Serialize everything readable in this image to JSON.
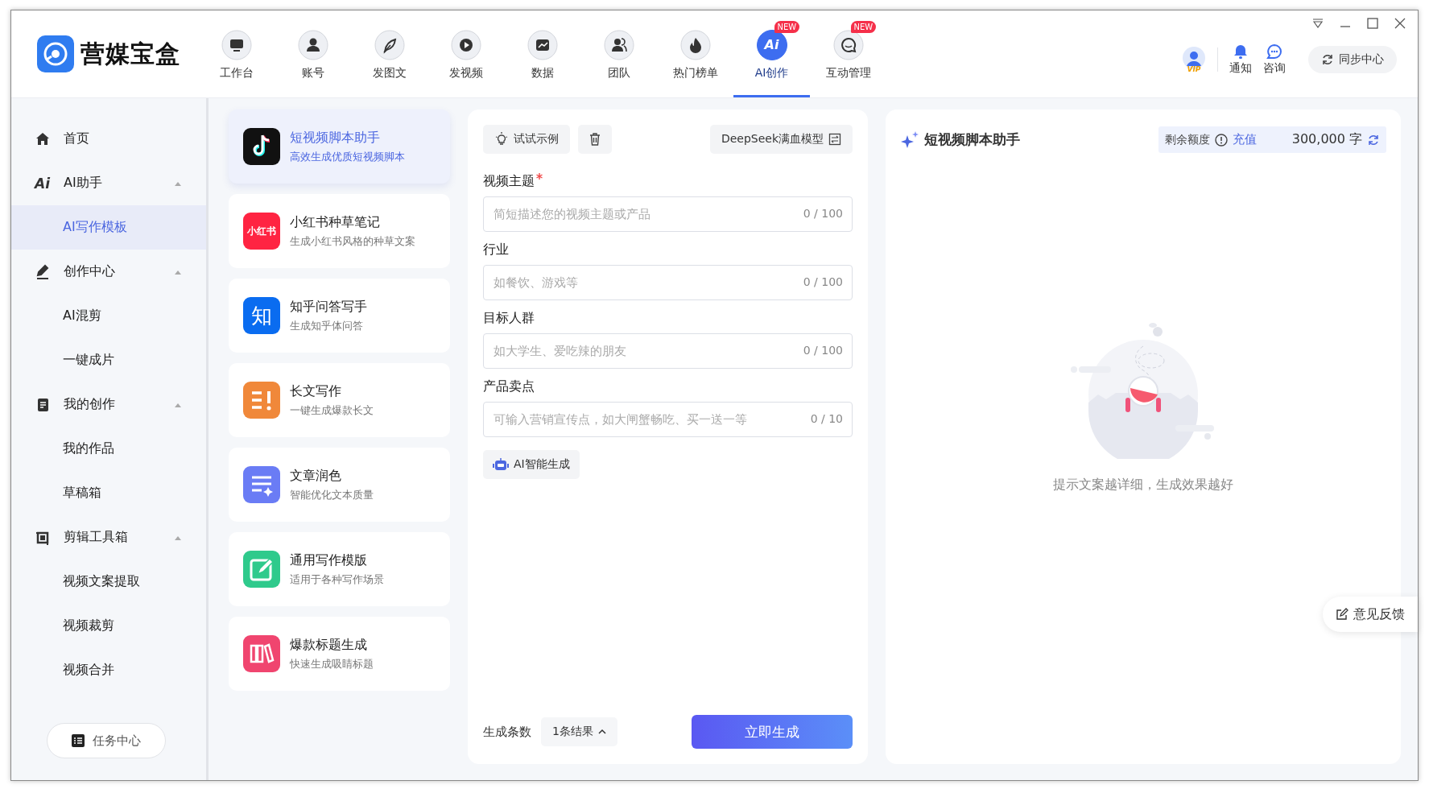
{
  "app": {
    "logo_text": "营媒宝盒"
  },
  "nav": [
    {
      "label": "工作台",
      "kind": "monitor",
      "selected": false
    },
    {
      "label": "账号",
      "kind": "person",
      "selected": false
    },
    {
      "label": "发图文",
      "kind": "feather",
      "selected": false
    },
    {
      "label": "发视频",
      "kind": "play",
      "selected": false
    },
    {
      "label": "数据",
      "kind": "chart",
      "selected": false
    },
    {
      "label": "团队",
      "kind": "team",
      "selected": false
    },
    {
      "label": "热门榜单",
      "kind": "flame",
      "selected": false
    },
    {
      "label": "AI创作",
      "kind": "ai",
      "icon_text": "Ai",
      "badge": "NEW",
      "selected": true
    },
    {
      "label": "互动管理",
      "kind": "chat",
      "badge": "NEW",
      "selected": false
    }
  ],
  "header_actions": {
    "vip_badge": "VIP",
    "notify": "通知",
    "consult": "咨询",
    "sync": "同步中心"
  },
  "sidebar": {
    "items": [
      {
        "label": "首页",
        "kind": "home",
        "selected": false
      },
      {
        "label": "AI助手",
        "kind": "ai",
        "icon_text": "Ai",
        "expanded": true,
        "selected": false,
        "children": [
          {
            "label": "AI写作模板",
            "selected": true
          }
        ]
      },
      {
        "label": "创作中心",
        "kind": "pen",
        "expanded": true,
        "selected": false,
        "children": [
          {
            "label": "AI混剪",
            "selected": false
          },
          {
            "label": "一键成片",
            "selected": false
          }
        ]
      },
      {
        "label": "我的创作",
        "kind": "doc",
        "expanded": true,
        "selected": false,
        "children": [
          {
            "label": "我的作品",
            "selected": false
          },
          {
            "label": "草稿箱",
            "selected": false
          }
        ]
      },
      {
        "label": "剪辑工具箱",
        "kind": "crop",
        "expanded": true,
        "selected": false,
        "children": [
          {
            "label": "视频文案提取",
            "selected": false
          },
          {
            "label": "视频裁剪",
            "selected": false
          },
          {
            "label": "视频合并",
            "selected": false
          }
        ]
      }
    ],
    "task_center": "任务中心"
  },
  "templates": [
    {
      "title": "短视频脚本助手",
      "subtitle": "高效生成优质短视频脚本",
      "kind": "douyin",
      "selected": true
    },
    {
      "title": "小红书种草笔记",
      "subtitle": "生成小红书风格的种草文案",
      "kind": "xiaohongshu",
      "icon_text": "小红书",
      "selected": false
    },
    {
      "title": "知乎问答写手",
      "subtitle": "生成知乎体问答",
      "kind": "zhihu",
      "icon_text": "知",
      "selected": false
    },
    {
      "title": "长文写作",
      "subtitle": "一键生成爆款长文",
      "kind": "longform",
      "selected": false
    },
    {
      "title": "文章润色",
      "subtitle": "智能优化文本质量",
      "kind": "polish",
      "selected": false
    },
    {
      "title": "通用写作模版",
      "subtitle": "适用于各种写作场景",
      "kind": "general",
      "selected": false
    },
    {
      "title": "爆款标题生成",
      "subtitle": "快速生成吸睛标题",
      "kind": "headline",
      "selected": false
    }
  ],
  "form": {
    "example_button": "试试示例",
    "model": "DeepSeek满血模型",
    "fields": [
      {
        "label": "视频主题",
        "required": true,
        "placeholder": "简短描述您的视频主题或产品",
        "counter": "0 / 100"
      },
      {
        "label": "行业",
        "required": false,
        "placeholder": "如餐饮、游戏等",
        "counter": "0 / 100"
      },
      {
        "label": "目标人群",
        "required": false,
        "placeholder": "如大学生、爱吃辣的朋友",
        "counter": "0 / 100"
      },
      {
        "label": "产品卖点",
        "required": false,
        "placeholder": "可输入营销宣传点，如大闸蟹畅吃、买一送一等",
        "counter": "0 / 10"
      }
    ],
    "ai_button": "AI智能生成",
    "count_label": "生成条数",
    "count_value": "1条结果",
    "submit": "立即生成"
  },
  "result": {
    "title": "短视频脚本助手",
    "quota_label": "剩余额度",
    "recharge": "充值",
    "amount": "300,000 字",
    "empty_hint": "提示文案越详细，生成效果越好"
  },
  "feedback": "意见反馈"
}
